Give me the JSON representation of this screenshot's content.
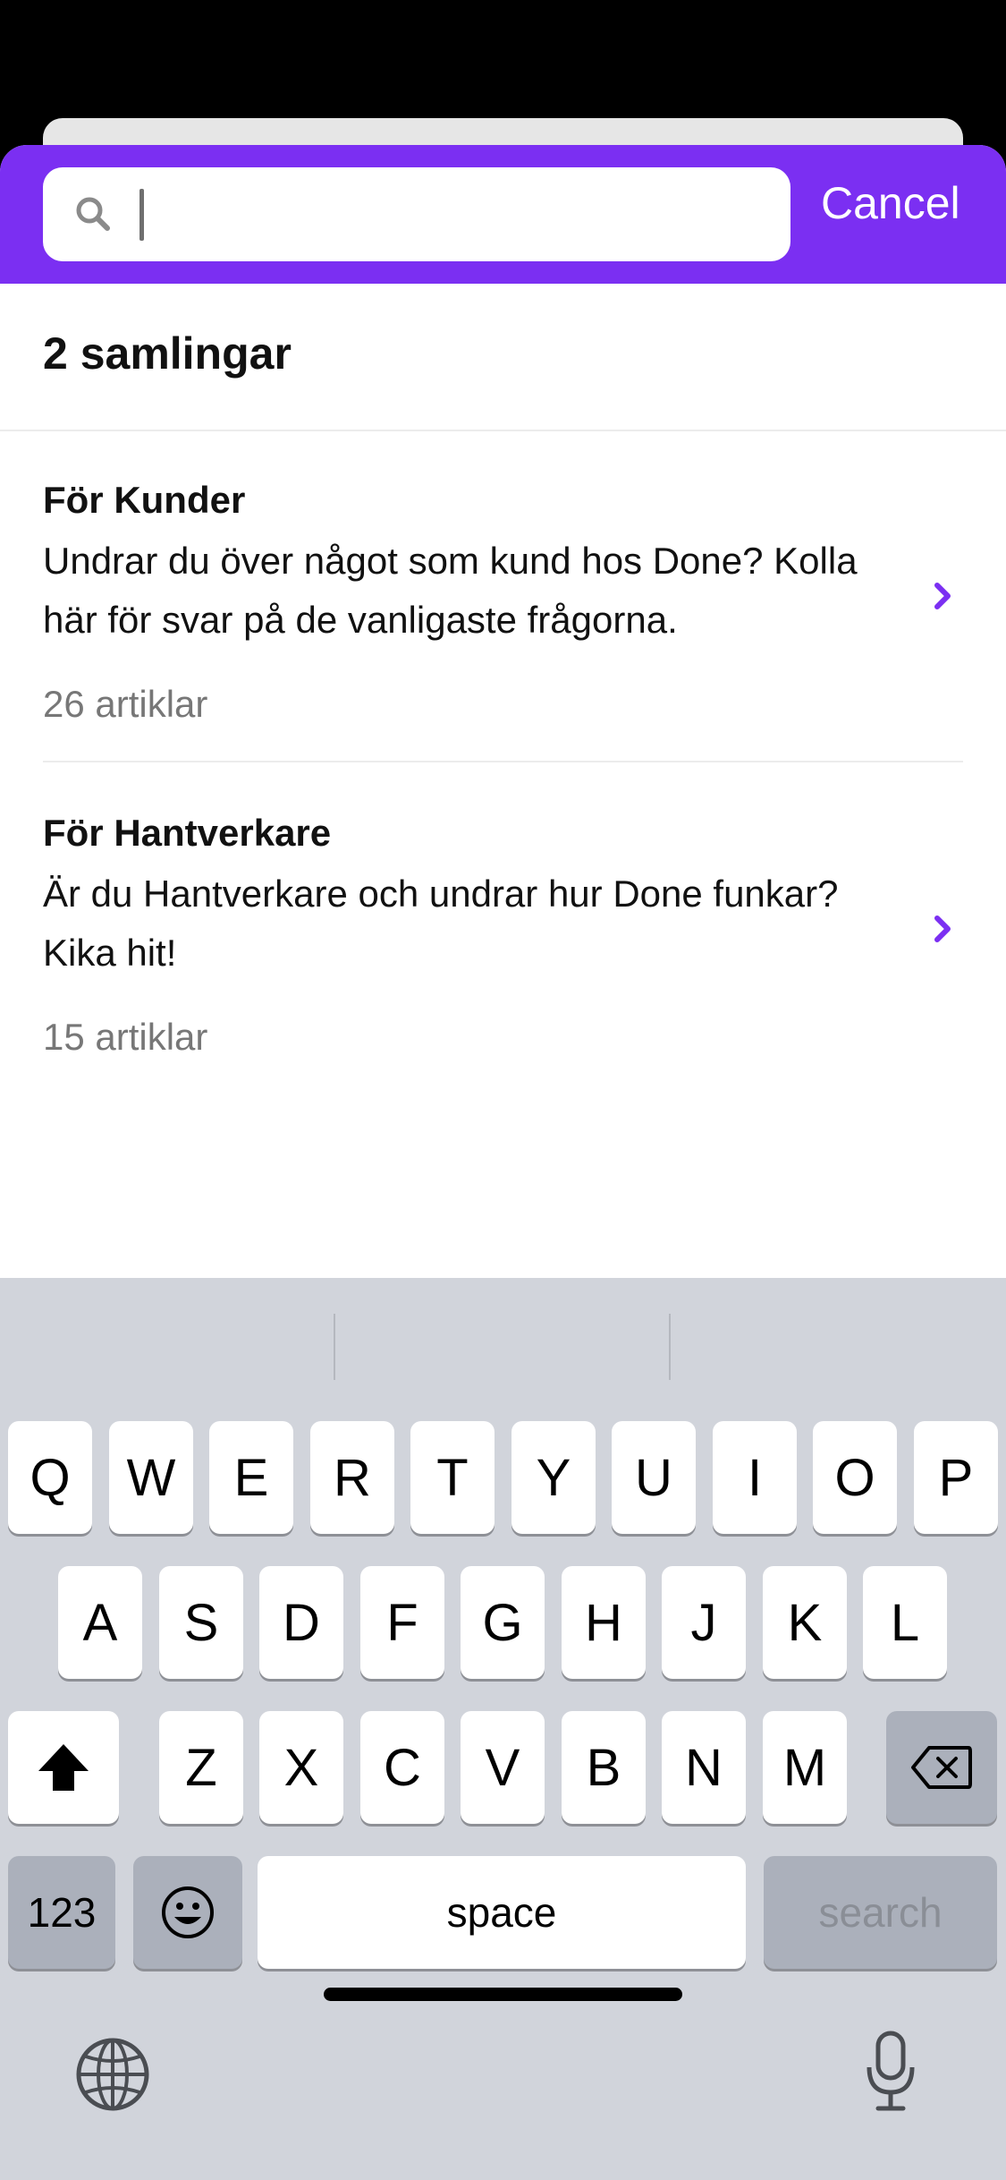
{
  "search": {
    "value": "",
    "cancel_label": "Cancel"
  },
  "collections_count_label": "2 samlingar",
  "collections": [
    {
      "title": "För Kunder",
      "description": "Undrar du över något som kund hos Done? Kolla här för svar på de vanligaste frågorna.",
      "articles": "26 artiklar"
    },
    {
      "title": "För Hantverkare",
      "description": "Är du Hantverkare och undrar hur Done funkar? Kika hit!",
      "articles": "15 artiklar"
    }
  ],
  "keyboard": {
    "row1": [
      "Q",
      "W",
      "E",
      "R",
      "T",
      "Y",
      "U",
      "I",
      "O",
      "P"
    ],
    "row2": [
      "A",
      "S",
      "D",
      "F",
      "G",
      "H",
      "J",
      "K",
      "L"
    ],
    "row3": [
      "Z",
      "X",
      "C",
      "V",
      "B",
      "N",
      "M"
    ],
    "numbers_label": "123",
    "space_label": "space",
    "search_label": "search"
  },
  "colors": {
    "accent": "#7b2ff2",
    "secondary_text": "#777777",
    "keyboard_bg": "#d1d4db"
  }
}
